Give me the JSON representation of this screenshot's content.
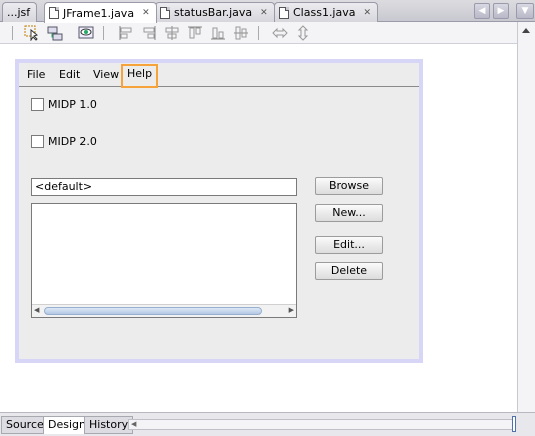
{
  "tabs": [
    {
      "label": "...jsf",
      "active": false
    },
    {
      "label": "JFrame1.java",
      "active": true
    },
    {
      "label": "statusBar.java",
      "active": false
    },
    {
      "label": "Class1.java",
      "active": false
    }
  ],
  "tab_close_glyph": "✕",
  "nav_buttons": {
    "left": "◀",
    "right": "▶",
    "menu": "▼"
  },
  "toolbar_icons": [
    "selection-mode-icon",
    "connection-mode-icon",
    "preview-design-icon",
    "align-left-icon",
    "align-right-icon",
    "center-horizontal-icon",
    "align-top-icon",
    "align-bottom-icon",
    "center-vertical-icon",
    "change-horizontal-resizability-icon",
    "change-vertical-resizability-icon"
  ],
  "design": {
    "menus": [
      {
        "label": "File",
        "selected": false
      },
      {
        "label": "Edit",
        "selected": false
      },
      {
        "label": "View",
        "selected": false
      },
      {
        "label": "Help",
        "selected": true
      }
    ],
    "checkboxes": [
      {
        "label": "MIDP 1.0",
        "checked": false
      },
      {
        "label": "MIDP 2.0",
        "checked": false
      }
    ],
    "combo_value": "<default>",
    "buttons": {
      "browse": "Browse",
      "new": "New...",
      "edit": "Edit...",
      "delete": "Delete"
    }
  },
  "view_tabs": [
    {
      "label": "Source",
      "active": false
    },
    {
      "label": "Design",
      "active": true
    },
    {
      "label": "History",
      "active": false
    }
  ],
  "colors": {
    "selection_highlight": "#f5a33a",
    "form_border": "#d8d6f6",
    "scroll_thumb": "#b4c8e2"
  }
}
